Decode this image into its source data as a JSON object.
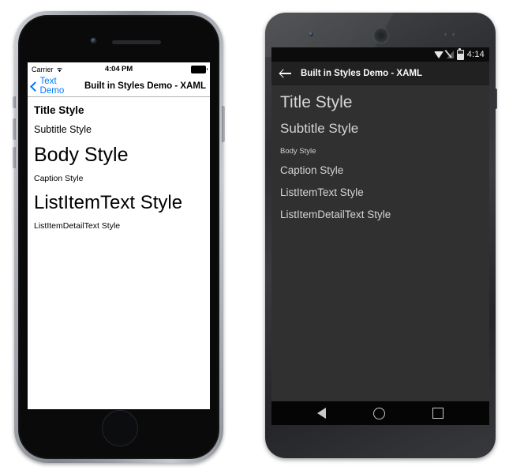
{
  "ios": {
    "status_bar": {
      "carrier": "Carrier",
      "wifi_icon": "wifi-icon",
      "time": "4:04 PM",
      "battery_icon": "battery-full-icon"
    },
    "nav_bar": {
      "back_icon": "chevron-left-icon",
      "back_label": "Text Demo",
      "title": "Built in Styles Demo - XAML"
    },
    "styles": {
      "title": "Title Style",
      "subtitle": "Subtitle Style",
      "body": "Body Style",
      "caption": "Caption Style",
      "list_item_text": "ListItemText Style",
      "list_item_detail_text": "ListItemDetailText Style"
    },
    "home_button": "home-button"
  },
  "android": {
    "status_bar": {
      "wifi_icon": "wifi-icon",
      "signal_icon": "signal-off-icon",
      "battery_icon": "battery-icon",
      "time": "4:14"
    },
    "app_bar": {
      "back_icon": "arrow-back-icon",
      "title": "Built in Styles Demo - XAML"
    },
    "styles": {
      "title": "Title Style",
      "subtitle": "Subtitle Style",
      "body": "Body Style",
      "caption": "Caption Style",
      "list_item_text": "ListItemText Style",
      "list_item_detail_text": "ListItemDetailText Style"
    },
    "nav_bar": {
      "back_icon": "nav-back-icon",
      "home_icon": "nav-home-icon",
      "recents_icon": "nav-recents-icon"
    }
  },
  "colors": {
    "ios_accent": "#007AFF",
    "ios_screen_bg": "#FFFFFF",
    "android_appbar_bg": "#212121",
    "android_content_bg": "#303030",
    "android_statusbar_bg": "#0C0C0C",
    "android_text": "#D4D4D4"
  }
}
